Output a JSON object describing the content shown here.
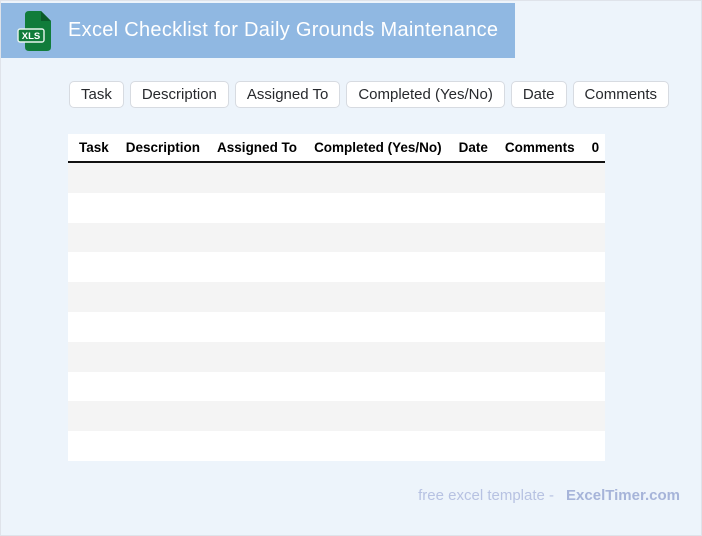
{
  "page": {
    "background": "#edf4fb",
    "border_color": "#dfe3ea"
  },
  "header": {
    "title": "Excel Checklist for Daily Grounds Maintenance",
    "background": "#90b8e2",
    "text_color": "#ffffff",
    "icon": {
      "name": "xls-file-icon",
      "badge": "XLS",
      "color": "#117c3a",
      "fold_color": "#0b5b2a"
    }
  },
  "chips": [
    {
      "label": "Task"
    },
    {
      "label": "Description"
    },
    {
      "label": "Assigned To"
    },
    {
      "label": "Completed (Yes/No)"
    },
    {
      "label": "Date"
    },
    {
      "label": "Comments"
    }
  ],
  "table": {
    "columns": [
      "Task",
      "Description",
      "Assigned To",
      "Completed (Yes/No)",
      "Date",
      "Comments",
      "0"
    ],
    "stripe_color": "#f4f4f4",
    "rows": [
      [
        "",
        "",
        "",
        "",
        "",
        "",
        ""
      ],
      [
        "",
        "",
        "",
        "",
        "",
        "",
        ""
      ],
      [
        "",
        "",
        "",
        "",
        "",
        "",
        ""
      ],
      [
        "",
        "",
        "",
        "",
        "",
        "",
        ""
      ],
      [
        "",
        "",
        "",
        "",
        "",
        "",
        ""
      ],
      [
        "",
        "",
        "",
        "",
        "",
        "",
        ""
      ],
      [
        "",
        "",
        "",
        "",
        "",
        "",
        ""
      ],
      [
        "",
        "",
        "",
        "",
        "",
        "",
        ""
      ],
      [
        "",
        "",
        "",
        "",
        "",
        "",
        ""
      ],
      [
        "",
        "",
        "",
        "",
        "",
        "",
        ""
      ]
    ]
  },
  "footer": {
    "prefix": "free excel template -",
    "brand": "ExcelTimer.com"
  }
}
